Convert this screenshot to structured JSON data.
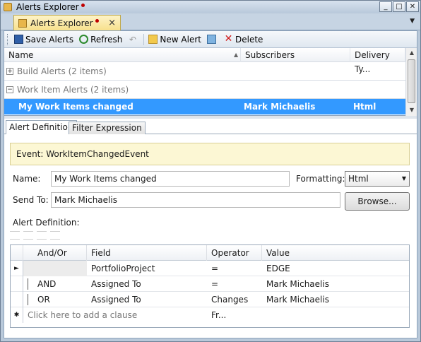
{
  "window": {
    "title": "Alerts Explorer"
  },
  "doc_tab": {
    "label": "Alerts Explorer",
    "close": "×"
  },
  "toolbar": {
    "save_label": "Save Alerts",
    "refresh_label": "Refresh",
    "new_alert_label": "New Alert",
    "delete_label": "Delete"
  },
  "list": {
    "columns": [
      "Name",
      "Subscribers",
      "Delivery Ty..."
    ],
    "groups": [
      {
        "expander": "+",
        "label": "Build Alerts (2 items)"
      },
      {
        "expander": "−",
        "label": "Work Item Alerts (2 items)"
      }
    ],
    "selected": {
      "name": "My Work Items changed",
      "subscribers": "Mark Michaelis",
      "delivery": "Html"
    }
  },
  "detail_tabs": {
    "active": "Alert Definition",
    "inactive": "Filter Expression"
  },
  "detail": {
    "event": "Event: WorkItemChangedEvent",
    "name_label": "Name:",
    "name_value": "My Work Items changed",
    "formatting_label": "Formatting:",
    "formatting_value": "Html",
    "sendto_label": "Send To:",
    "sendto_value": "Mark Michaelis",
    "browse_label": "Browse...",
    "alert_def_label": "Alert Definition:"
  },
  "grid": {
    "columns": [
      "And/Or",
      "Field",
      "Operator",
      "Value"
    ],
    "rows": [
      {
        "andor": "",
        "field": "PortfolioProject",
        "operator": "=",
        "value": "EDGE"
      },
      {
        "andor": "AND",
        "field": "Assigned To",
        "operator": "=",
        "value": "Mark Michaelis"
      },
      {
        "andor": "OR",
        "field": "Assigned To",
        "operator": "Changes Fr...",
        "value": "Mark Michaelis"
      }
    ],
    "add_clause": "Click here to add a clause"
  },
  "colors": {
    "selection": "#3399ff",
    "event_bg": "#fcf7d4",
    "tab_active": "#f7e08c",
    "chrome": "#b9c9da"
  }
}
